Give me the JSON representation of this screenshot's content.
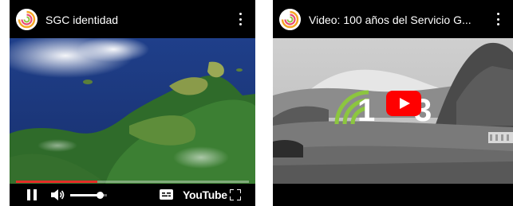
{
  "players": [
    {
      "channel_logo_icon": "sgc-spiral-logo-icon",
      "title": "SGC identidad",
      "menu_icon": "more-vertical-icon",
      "state": "playing",
      "progress_fraction": 0.35,
      "volume_fraction": 0.8,
      "controls": {
        "pause_icon": "pause-icon",
        "volume_icon": "volume-icon",
        "captions_icon": "captions-icon",
        "youtube_label": "YouTube",
        "fullscreen_icon": "fullscreen-icon"
      },
      "colors": {
        "progress": "#e52d27"
      }
    },
    {
      "channel_logo_icon": "sgc-spiral-logo-icon",
      "title": "Video: 100 años del Servicio G...",
      "menu_icon": "more-vertical-icon",
      "state": "paused",
      "play_button_icon": "youtube-play-icon",
      "overlay_logo": {
        "digits_left": "1",
        "digits_right": "3"
      },
      "colors": {
        "play_button": "#ff0000",
        "logo_green": "#8cc63f"
      }
    }
  ]
}
